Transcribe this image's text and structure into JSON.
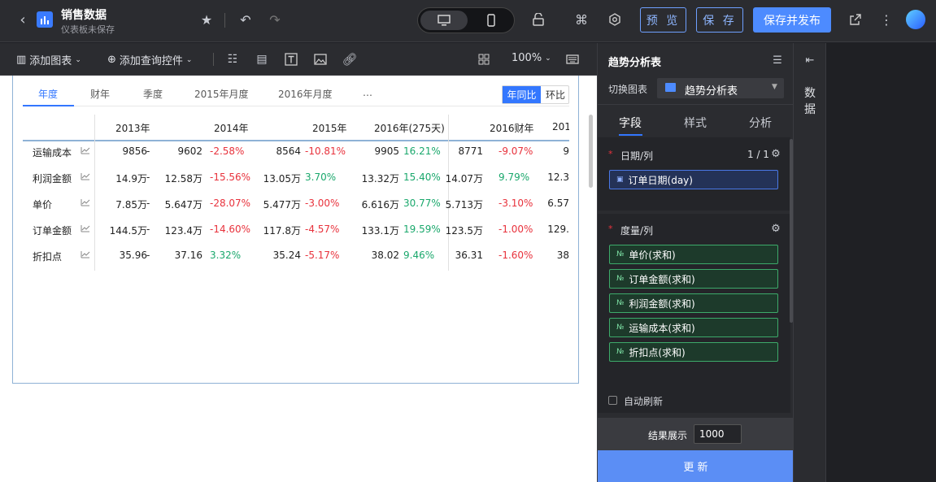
{
  "header": {
    "title": "销售数据",
    "subtitle": "仪表板未保存",
    "preview": "预 览",
    "save": "保 存",
    "publish": "保存并发布"
  },
  "toolbar": {
    "add_chart": "添加图表",
    "add_query": "添加查询控件",
    "zoom": "100%"
  },
  "tabs": [
    "年度",
    "财年",
    "季度",
    "2015年月度",
    "2016年月度",
    "…"
  ],
  "compare": {
    "yoy": "年同比",
    "mom": "环比"
  },
  "table": {
    "columns": [
      "2013年",
      "2014年",
      "2015年",
      "2016年(275天)",
      "2016财年",
      "201"
    ],
    "rows": [
      {
        "name": "运输成本",
        "v2013": "9856",
        "d2013": "-",
        "v2014": "9602",
        "c2014": "-2.58%",
        "v2015": "8564",
        "c2015": "-10.81%",
        "v2016": "9905",
        "c2016": "16.21%",
        "vfy": "8771",
        "cfy": "-9.07%",
        "vx": "9"
      },
      {
        "name": "利润金额",
        "v2013": "14.9万",
        "d2013": "-",
        "v2014": "12.58万",
        "c2014": "-15.56%",
        "v2015": "13.05万",
        "c2015": "3.70%",
        "v2016": "13.32万",
        "c2016": "15.40%",
        "vfy": "14.07万",
        "cfy": "9.79%",
        "vx": "12.3"
      },
      {
        "name": "单价",
        "v2013": "7.85万",
        "d2013": "-",
        "v2014": "5.647万",
        "c2014": "-28.07%",
        "v2015": "5.477万",
        "c2015": "-3.00%",
        "v2016": "6.616万",
        "c2016": "30.77%",
        "vfy": "5.713万",
        "cfy": "-3.10%",
        "vx": "6.57"
      },
      {
        "name": "订单金额",
        "v2013": "144.5万",
        "d2013": "-",
        "v2014": "123.4万",
        "c2014": "-14.60%",
        "v2015": "117.8万",
        "c2015": "-4.57%",
        "v2016": "133.1万",
        "c2016": "19.59%",
        "vfy": "123.5万",
        "cfy": "-1.00%",
        "vx": "129."
      },
      {
        "name": "折扣点",
        "v2013": "35.96",
        "d2013": "-",
        "v2014": "37.16",
        "c2014": "3.32%",
        "v2015": "35.24",
        "c2015": "-5.17%",
        "v2016": "38.02",
        "c2016": "9.46%",
        "vfy": "36.31",
        "cfy": "-1.60%",
        "vx": "38"
      }
    ]
  },
  "panel": {
    "title": "趋势分析表",
    "switch_label": "切换图表",
    "chart_type": "趋势分析表",
    "tabs": [
      "字段",
      "样式",
      "分析"
    ],
    "date_label": "日期/列",
    "date_count": "1 / 1",
    "date_field": "订单日期(day)",
    "measure_label": "度量/列",
    "measures": [
      "单价(求和)",
      "订单金额(求和)",
      "利润金额(求和)",
      "运输成本(求和)",
      "折扣点(求和)"
    ],
    "auto_refresh": "自动刷新",
    "result_label": "结果展示",
    "result_value": "1000",
    "update": "更 新"
  },
  "side": {
    "label": "数据"
  },
  "colors": {
    "accent": "#3377ff",
    "positive": "#1aa86c",
    "negative": "#e8323c"
  }
}
